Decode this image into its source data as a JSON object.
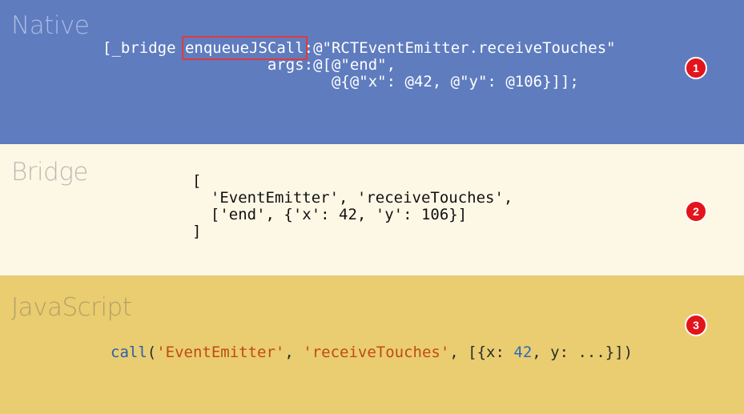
{
  "native": {
    "title": "Native",
    "line1_prefix": "[_bridge ",
    "line1_method": "enqueueJSCall",
    "line1_suffix": ":@\"RCTEventEmitter.receiveTouches\"",
    "line2": "                  args:@[@\"end\",",
    "line3": "                         @{@\"x\": @42, @\"y\": @106}]];",
    "marker": "1",
    "highlight_color": "#e23a3a"
  },
  "bridge": {
    "title": "Bridge",
    "line1": "[",
    "line2": "  'EventEmitter', 'receiveTouches',",
    "line3": "  ['end', {'x': 42, 'y': 106}]",
    "line4": "]",
    "marker": "2"
  },
  "javascript": {
    "title": "JavaScript",
    "fn": "call",
    "open": "(",
    "arg1": "'EventEmitter'",
    "sep1": ", ",
    "arg2": "'receiveTouches'",
    "sep2": ", [{x: ",
    "x_val": "42",
    "sep3": ", y: ...}])",
    "marker": "3"
  },
  "colors": {
    "native_band": "#5f7cbf",
    "bridge_band": "#fdf8e5",
    "javascript_band": "#e9cd70",
    "marker_fill": "#e3141b"
  }
}
